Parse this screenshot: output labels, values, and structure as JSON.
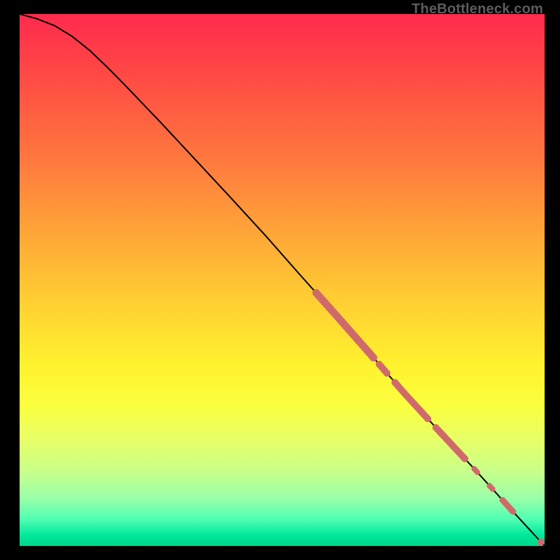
{
  "watermark": "TheBottleneck.com",
  "chart_data": {
    "type": "line",
    "title": "",
    "xlabel": "",
    "ylabel": "",
    "xlim": [
      0,
      100
    ],
    "ylim": [
      0,
      100
    ],
    "grid": false,
    "legend": false,
    "curve": [
      {
        "x": 0.0,
        "y": 100.0
      },
      {
        "x": 3.3,
        "y": 99.1
      },
      {
        "x": 6.7,
        "y": 97.8
      },
      {
        "x": 10.0,
        "y": 95.8
      },
      {
        "x": 13.3,
        "y": 93.2
      },
      {
        "x": 16.7,
        "y": 90.0
      },
      {
        "x": 20.0,
        "y": 86.7
      },
      {
        "x": 26.7,
        "y": 79.8
      },
      {
        "x": 33.3,
        "y": 72.8
      },
      {
        "x": 40.0,
        "y": 65.7
      },
      {
        "x": 46.7,
        "y": 58.5
      },
      {
        "x": 53.3,
        "y": 51.1
      },
      {
        "x": 60.0,
        "y": 43.7
      },
      {
        "x": 66.7,
        "y": 36.2
      },
      {
        "x": 73.3,
        "y": 28.7
      },
      {
        "x": 80.0,
        "y": 21.5
      },
      {
        "x": 86.7,
        "y": 14.4
      },
      {
        "x": 93.3,
        "y": 7.2
      },
      {
        "x": 100.0,
        "y": 0.0
      }
    ],
    "markers_along_curve": {
      "color": "#cf6a6a",
      "segments": [
        {
          "x_start": 56.5,
          "x_end": 67.5,
          "radius": 5.5
        },
        {
          "x_start": 68.5,
          "x_end": 70.0,
          "radius": 5.0
        },
        {
          "x_start": 71.5,
          "x_end": 78.0,
          "radius": 5.0
        },
        {
          "x_start": 79.3,
          "x_end": 84.8,
          "radius": 5.0
        },
        {
          "x_start": 86.6,
          "x_end": 87.4,
          "radius": 4.0
        },
        {
          "x_start": 89.5,
          "x_end": 90.3,
          "radius": 4.0
        },
        {
          "x_start": 92.0,
          "x_end": 94.2,
          "radius": 4.5
        }
      ],
      "singles": [
        {
          "x": 99.3,
          "radius": 5.0
        }
      ]
    },
    "gradient_stops": [
      {
        "pos": 0.0,
        "color": "#ff2a4d"
      },
      {
        "pos": 0.12,
        "color": "#ff4b44"
      },
      {
        "pos": 0.28,
        "color": "#ff7a3e"
      },
      {
        "pos": 0.42,
        "color": "#ffa837"
      },
      {
        "pos": 0.55,
        "color": "#ffd232"
      },
      {
        "pos": 0.66,
        "color": "#fff22e"
      },
      {
        "pos": 0.74,
        "color": "#faff40"
      },
      {
        "pos": 0.8,
        "color": "#e7ff68"
      },
      {
        "pos": 0.86,
        "color": "#c8ff8a"
      },
      {
        "pos": 0.91,
        "color": "#9affa8"
      },
      {
        "pos": 0.95,
        "color": "#4fffb3"
      },
      {
        "pos": 0.98,
        "color": "#00e89a"
      },
      {
        "pos": 1.0,
        "color": "#00d489"
      }
    ]
  }
}
